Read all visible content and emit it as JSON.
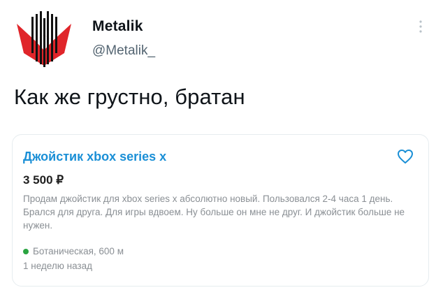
{
  "author": {
    "name": "Metalik",
    "handle": "@Metalik_"
  },
  "tweet": {
    "text": "Как же грустно, братан"
  },
  "listing": {
    "title": "Джойстик xbox series x",
    "price": "3 500 ₽",
    "description": "Продам джойстик для xbox series x абсолютно новый. Пользовался 2-4 часа 1 день. Брался для друга. Для игры вдвоем. Ну больше он мне не друг. И джойстик больше не нужен.",
    "location": "Ботаническая, 600 м",
    "posted": "1 неделю назад"
  },
  "icons": {
    "avatar": "bat-wing-logo",
    "more": "more-vertical-icon",
    "favorite": "heart-icon",
    "metro": "metro-dot-icon"
  },
  "colors": {
    "title_link": "#1a8fd6",
    "metro_line": "#2aa441",
    "avatar_red": "#e0252a"
  }
}
